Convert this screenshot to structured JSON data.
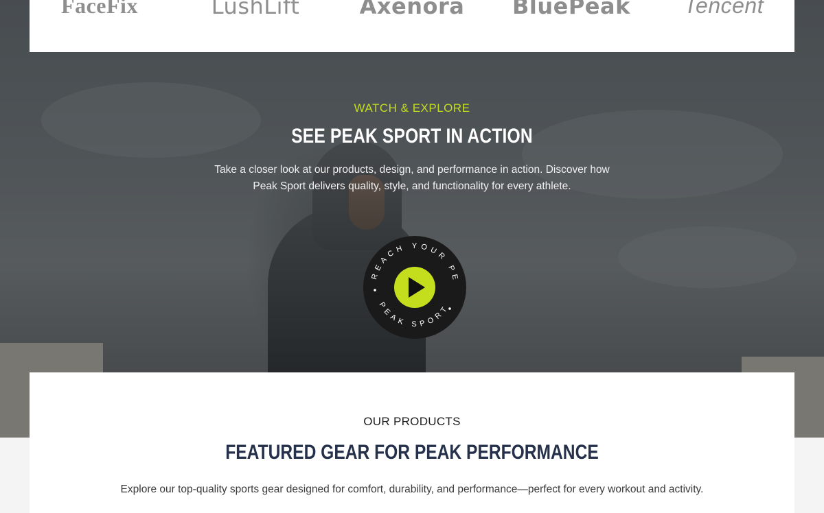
{
  "logos": [
    {
      "name": "FaceFix"
    },
    {
      "name": "LushLift"
    },
    {
      "name": "Axenora"
    },
    {
      "name": "BluePeak"
    },
    {
      "name": "Tencent"
    }
  ],
  "video_section": {
    "eyebrow": "WATCH & EXPLORE",
    "title": "SEE PEAK SPORT IN ACTION",
    "description": "Take a closer look at our products, design, and performance in action. Discover how Peak Sport delivers quality, style, and functionality for every athlete.",
    "play_badge_text_top": "REACH YOUR PEAK",
    "play_badge_text_bottom": "PEAK SPORT",
    "accent_color": "#c4de1e",
    "play_icon": "play-icon"
  },
  "products_section": {
    "eyebrow": "OUR PRODUCTS",
    "title": "FEATURED GEAR FOR PEAK PERFORMANCE",
    "description": "Explore our top-quality sports gear designed for comfort, durability, and performance—perfect for every workout and activity."
  }
}
